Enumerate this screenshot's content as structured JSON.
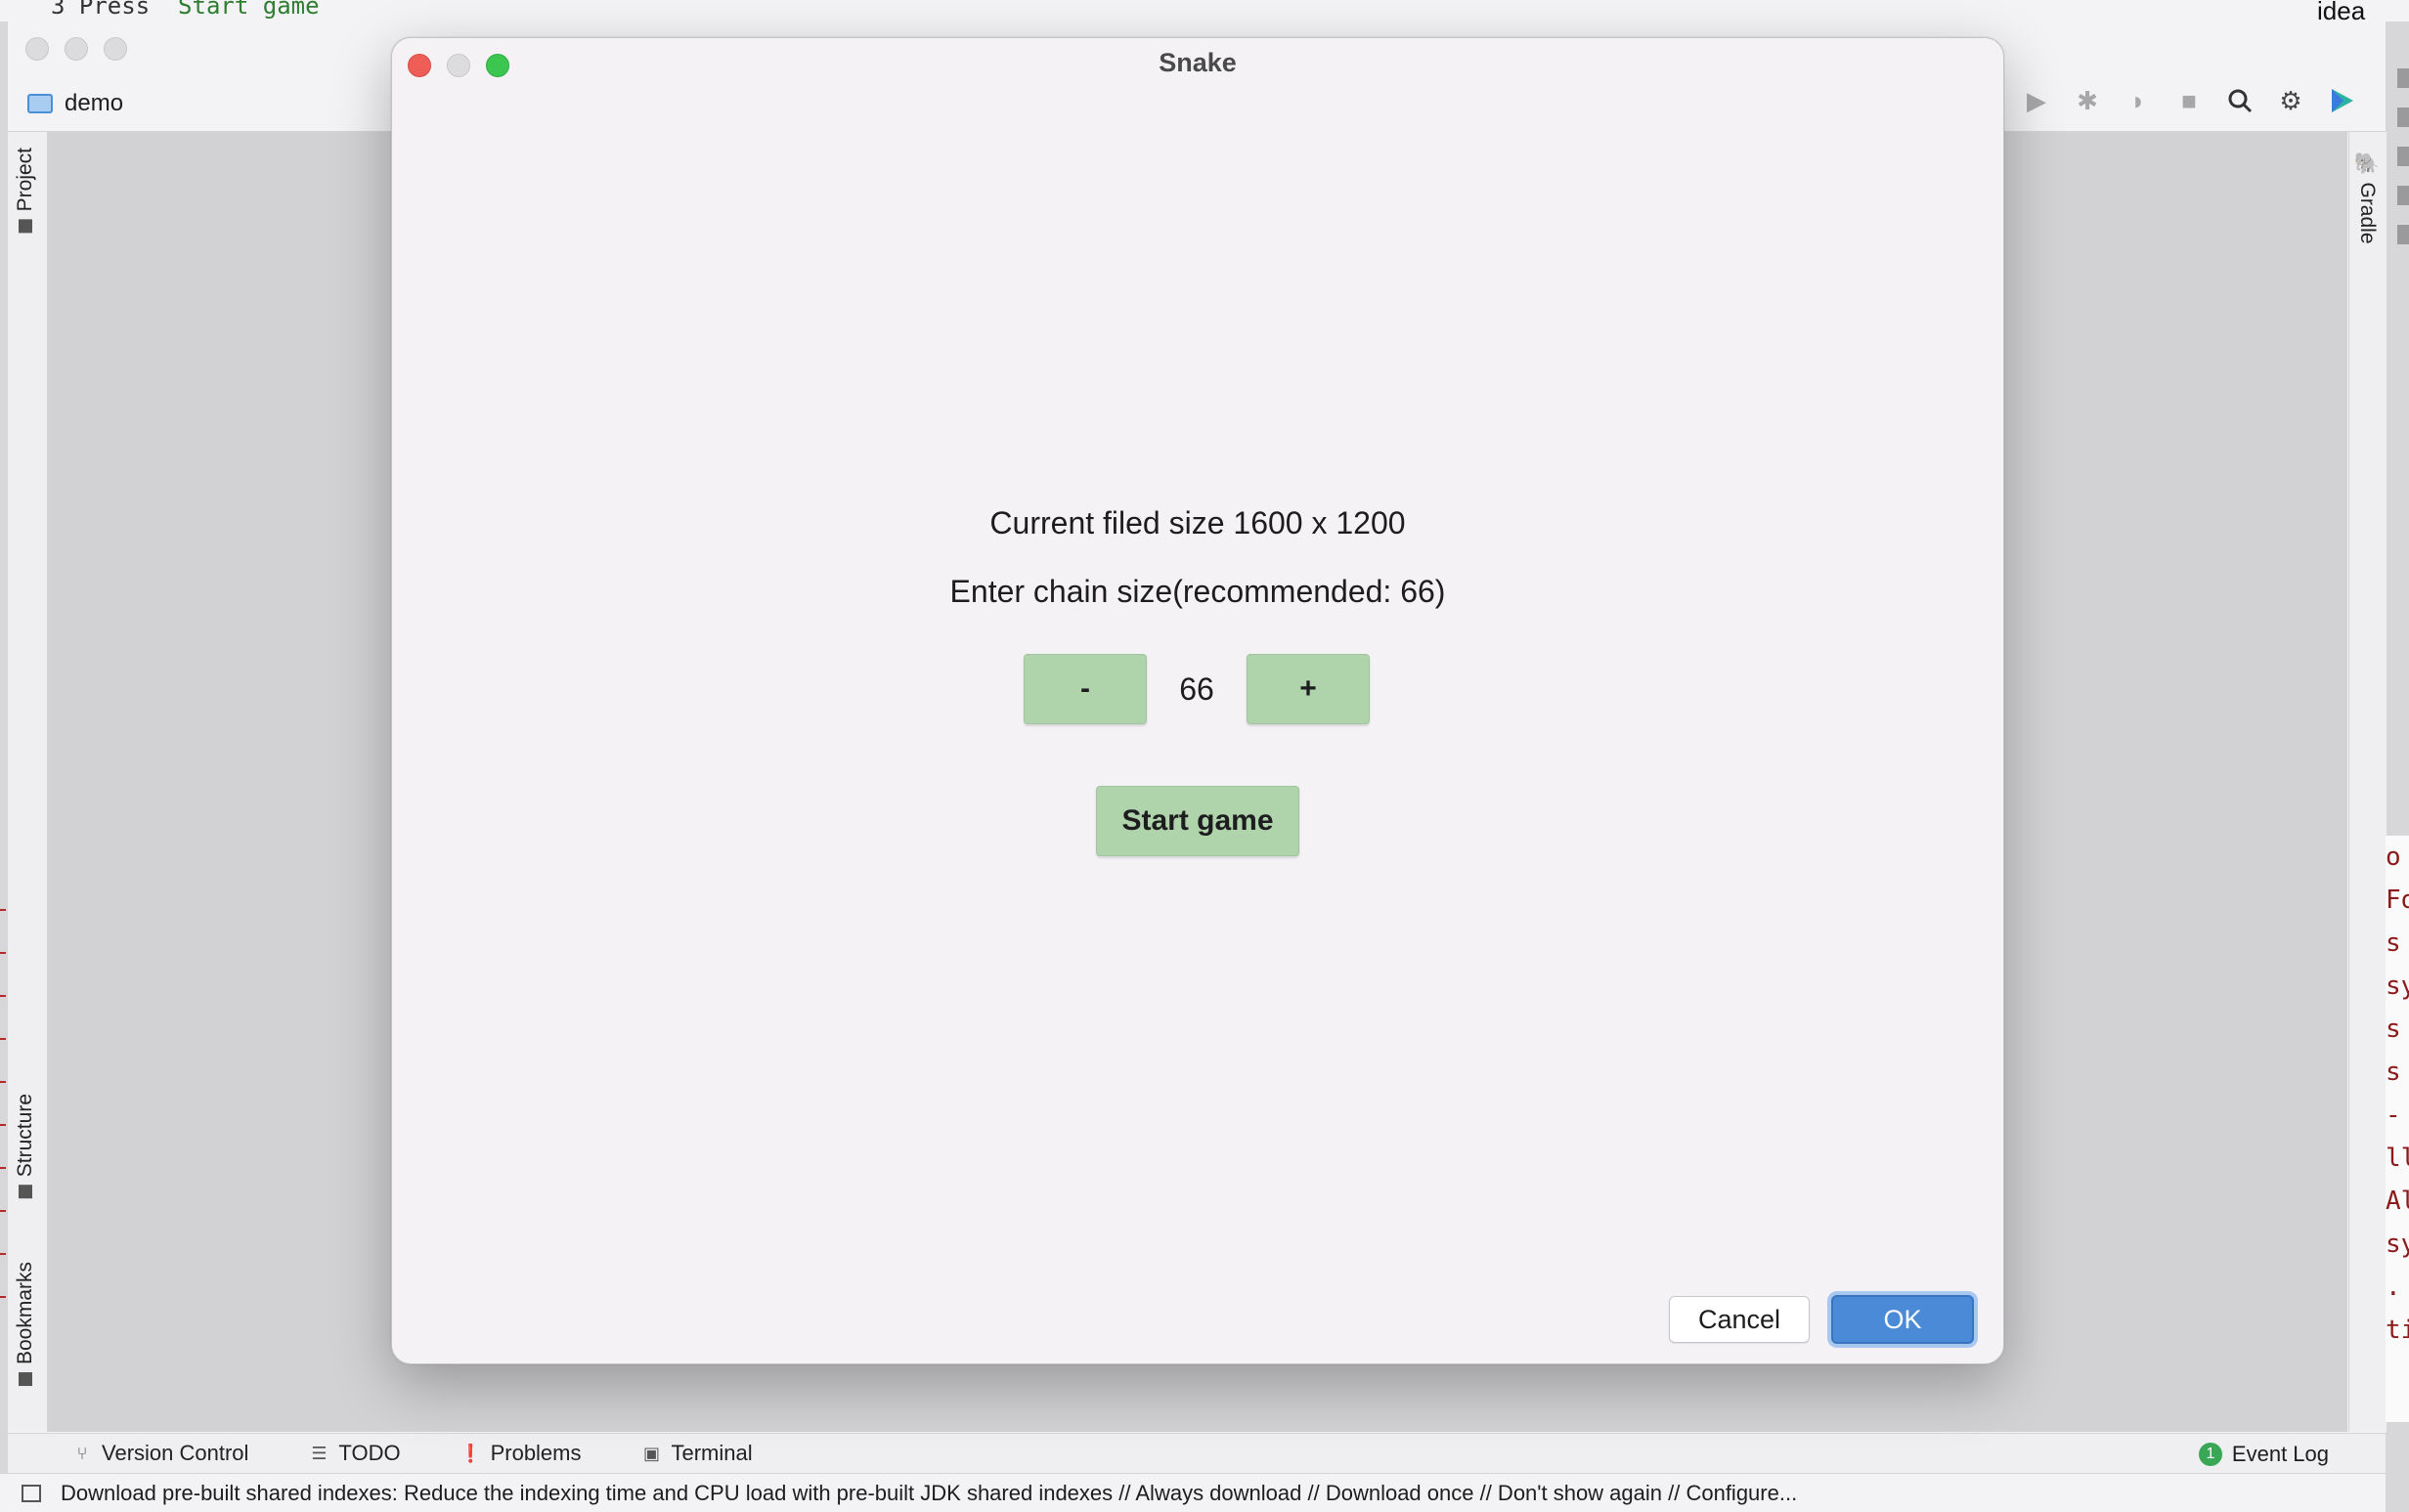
{
  "background": {
    "top_code_peek_prefix": "3  Press `",
    "top_code_peek_highlight": "Start game`",
    "top_right_peek": "idea",
    "project_name": "demo",
    "left_tabs": [
      "Project",
      "Structure",
      "Bookmarks"
    ],
    "right_tab": "Gradle",
    "right_code_chars": [
      "o",
      "Fo",
      "s",
      "sy",
      "s",
      "s",
      "-",
      "ll",
      "Al",
      "sy",
      ".",
      "ti"
    ]
  },
  "bottom_tabs": [
    {
      "label": "Version Control",
      "icon": "branch-icon"
    },
    {
      "label": "TODO",
      "icon": "list-icon"
    },
    {
      "label": "Problems",
      "icon": "warning-icon"
    },
    {
      "label": "Terminal",
      "icon": "terminal-icon"
    }
  ],
  "event_log": {
    "label": "Event Log",
    "count": "1"
  },
  "status_bar": {
    "message": "Download pre-built shared indexes: Reduce the indexing time and CPU load with pre-built JDK shared indexes // Always download // Download once // Don't show again // Configure..."
  },
  "dialog": {
    "title": "Snake",
    "field_size_text": "Current filed size 1600 x 1200",
    "chain_prompt": "Enter chain size(recommended: 66)",
    "minus_label": "-",
    "chain_value": "66",
    "plus_label": "+",
    "start_label": "Start game",
    "cancel_label": "Cancel",
    "ok_label": "OK"
  },
  "colors": {
    "green_button": "#afd4ab",
    "ok_button": "#4a8ad6",
    "close_light": "#ee5e57",
    "zoom_light": "#3bc650"
  }
}
